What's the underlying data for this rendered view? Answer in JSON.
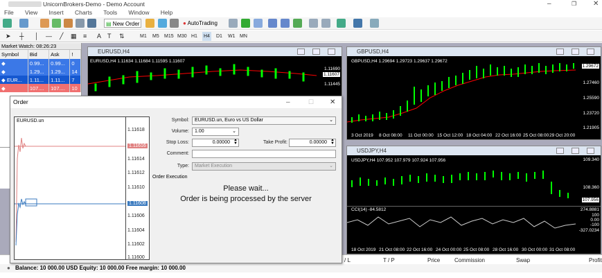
{
  "window": {
    "title": "UnicornBrokers-Demo - Demo Account"
  },
  "menu": [
    "File",
    "View",
    "Insert",
    "Charts",
    "Tools",
    "Window",
    "Help"
  ],
  "toolbar": {
    "new_order": "New Order",
    "autotrading": "AutoTrading"
  },
  "timeframes": [
    "M1",
    "M5",
    "M15",
    "M30",
    "H1",
    "H4",
    "D1",
    "W1",
    "MN"
  ],
  "market_watch": {
    "title": "Market Watch: 08:26:23",
    "columns": [
      "Symbol",
      "Bid",
      "Ask",
      "!"
    ],
    "rows": [
      {
        "symbol": "",
        "bid": "0.99...",
        "ask": "0.99...",
        "spread": "0"
      },
      {
        "symbol": "",
        "bid": "1.29...",
        "ask": "1.29...",
        "spread": "14"
      },
      {
        "symbol": "EUR...",
        "bid": "1.11...",
        "ask": "1.11...",
        "spread": "7"
      },
      {
        "symbol": "",
        "bid": "107....",
        "ask": "107....",
        "spread": "10"
      }
    ]
  },
  "charts": {
    "eurusd": {
      "title": "EURUSD,H4",
      "info": "EURUSD,H4  1.11634 1.11684 1.11595 1.11607",
      "prices": [
        "1.11690",
        "1.11607",
        "1.11445"
      ]
    },
    "gbpusd": {
      "title": "GBPUSD,H4",
      "info": "GBPUSD,H4  1.29694 1.29723 1.29637 1.29672",
      "prices": [
        "1.29672",
        "1.27460",
        "1.25590",
        "1.23720",
        "1.21905"
      ],
      "xticks": [
        "3 Oct 2019",
        "8 Oct 08:00",
        "11 Oct 00:00",
        "15 Oct 12:00",
        "18 Oct 04:00",
        "22 Oct 16:00",
        "25 Oct 08:00",
        "29 Oct 20:00"
      ]
    },
    "usdjpy": {
      "title": "USDJPY,H4",
      "info": "USDJPY,H4  107.952 107.979 107.924 107.956",
      "prices": [
        "109.340",
        "108.360",
        "107.956"
      ],
      "cci": "CCI(14) -84.5812",
      "cci_levels": [
        "274.8881",
        "100",
        "0.00",
        "-100",
        "-327.0234"
      ],
      "xticks": [
        "18 Oct 2019",
        "21 Oct 08:00",
        "22 Oct 16:00",
        "24 Oct 00:00",
        "25 Oct 08:00",
        "28 Oct 16:00",
        "30 Oct 00:00",
        "31 Oct 08:00"
      ]
    }
  },
  "order": {
    "title": "Order",
    "chart_symbol": "EURUSD.un",
    "chart_prices": [
      "1.11618",
      "1.11616",
      "1.11614",
      "1.11612",
      "1.11610",
      "1.11608",
      "1.11606",
      "1.11604",
      "1.11602",
      "1.11600"
    ],
    "ask_marker": "1.11616",
    "bid_marker": "1.11608",
    "symbol_label": "Symbol:",
    "symbol_value": "EURUSD.un, Euro vs US Dollar",
    "volume_label": "Volume:",
    "volume_value": "1.00",
    "sl_label": "Stop Loss:",
    "sl_value": "0.00000",
    "tp_label": "Take Profit:",
    "tp_value": "0.00000",
    "comment_label": "Comment:",
    "comment_value": "",
    "type_label": "Type:",
    "type_value": "Market Execution",
    "section": "Order Execution",
    "wait": "Please wait...",
    "processing": "Order is being processed by the server"
  },
  "terminal": {
    "columns": [
      "/ L",
      "T / P",
      "Price",
      "Commission",
      "Swap",
      "Profit"
    ]
  },
  "status": {
    "balance": "Balance: 10 000.00 USD  Equity: 10 000.00  Free margin: 10 000.00"
  },
  "colors": {
    "accent": "#3b78e7",
    "bull": "#00ff00",
    "ma": "#ff0000"
  }
}
